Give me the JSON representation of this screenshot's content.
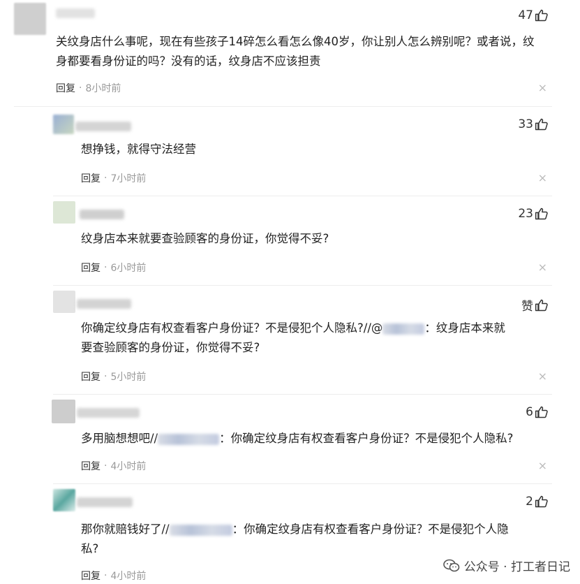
{
  "comments": [
    {
      "likes": "47",
      "text": "关纹身店什么事呢，现在有些孩子14碎怎么看怎么像40岁，你让别人怎么辨别呢？或者说，纹身都要看身份证的吗？没有的话，纹身店不应该担责",
      "reply": "回复",
      "time": "8小时前",
      "close": "×"
    },
    {
      "likes": "33",
      "text": "想挣钱，就得守法经营",
      "reply": "回复",
      "time": "7小时前",
      "close": "×"
    },
    {
      "likes": "23",
      "text": "纹身店本来就要查验顾客的身份证，你觉得不妥?",
      "reply": "回复",
      "time": "6小时前",
      "close": "×"
    },
    {
      "likes": "赞",
      "text_a": "你确定纹身店有权查看客户身份证？不是侵犯个人隐私?//@",
      "text_b": "：纹身店本来就",
      "text_c": "要查验顾客的身份证，你觉得不妥?",
      "reply": "回复",
      "time": "5小时前",
      "close": "×"
    },
    {
      "likes": "6",
      "text_a": "多用脑想想吧//",
      "text_b": "：你确定纹身店有权查看客户身份证？不是侵犯个人隐私?",
      "reply": "回复",
      "time": "4小时前",
      "close": "×"
    },
    {
      "likes": "2",
      "text_a": "那你就赔钱好了//",
      "text_b": "：你确定纹身店有权查看客户身份证？不是侵犯个人隐",
      "text_c": "私?",
      "reply": "回复",
      "time": "4小时前"
    }
  ],
  "separator": "·",
  "watermark": "公众号 · 打工者日记",
  "icons": {
    "like": "thumbs-up-icon",
    "close": "close-icon",
    "wechat": "wechat-icon"
  }
}
